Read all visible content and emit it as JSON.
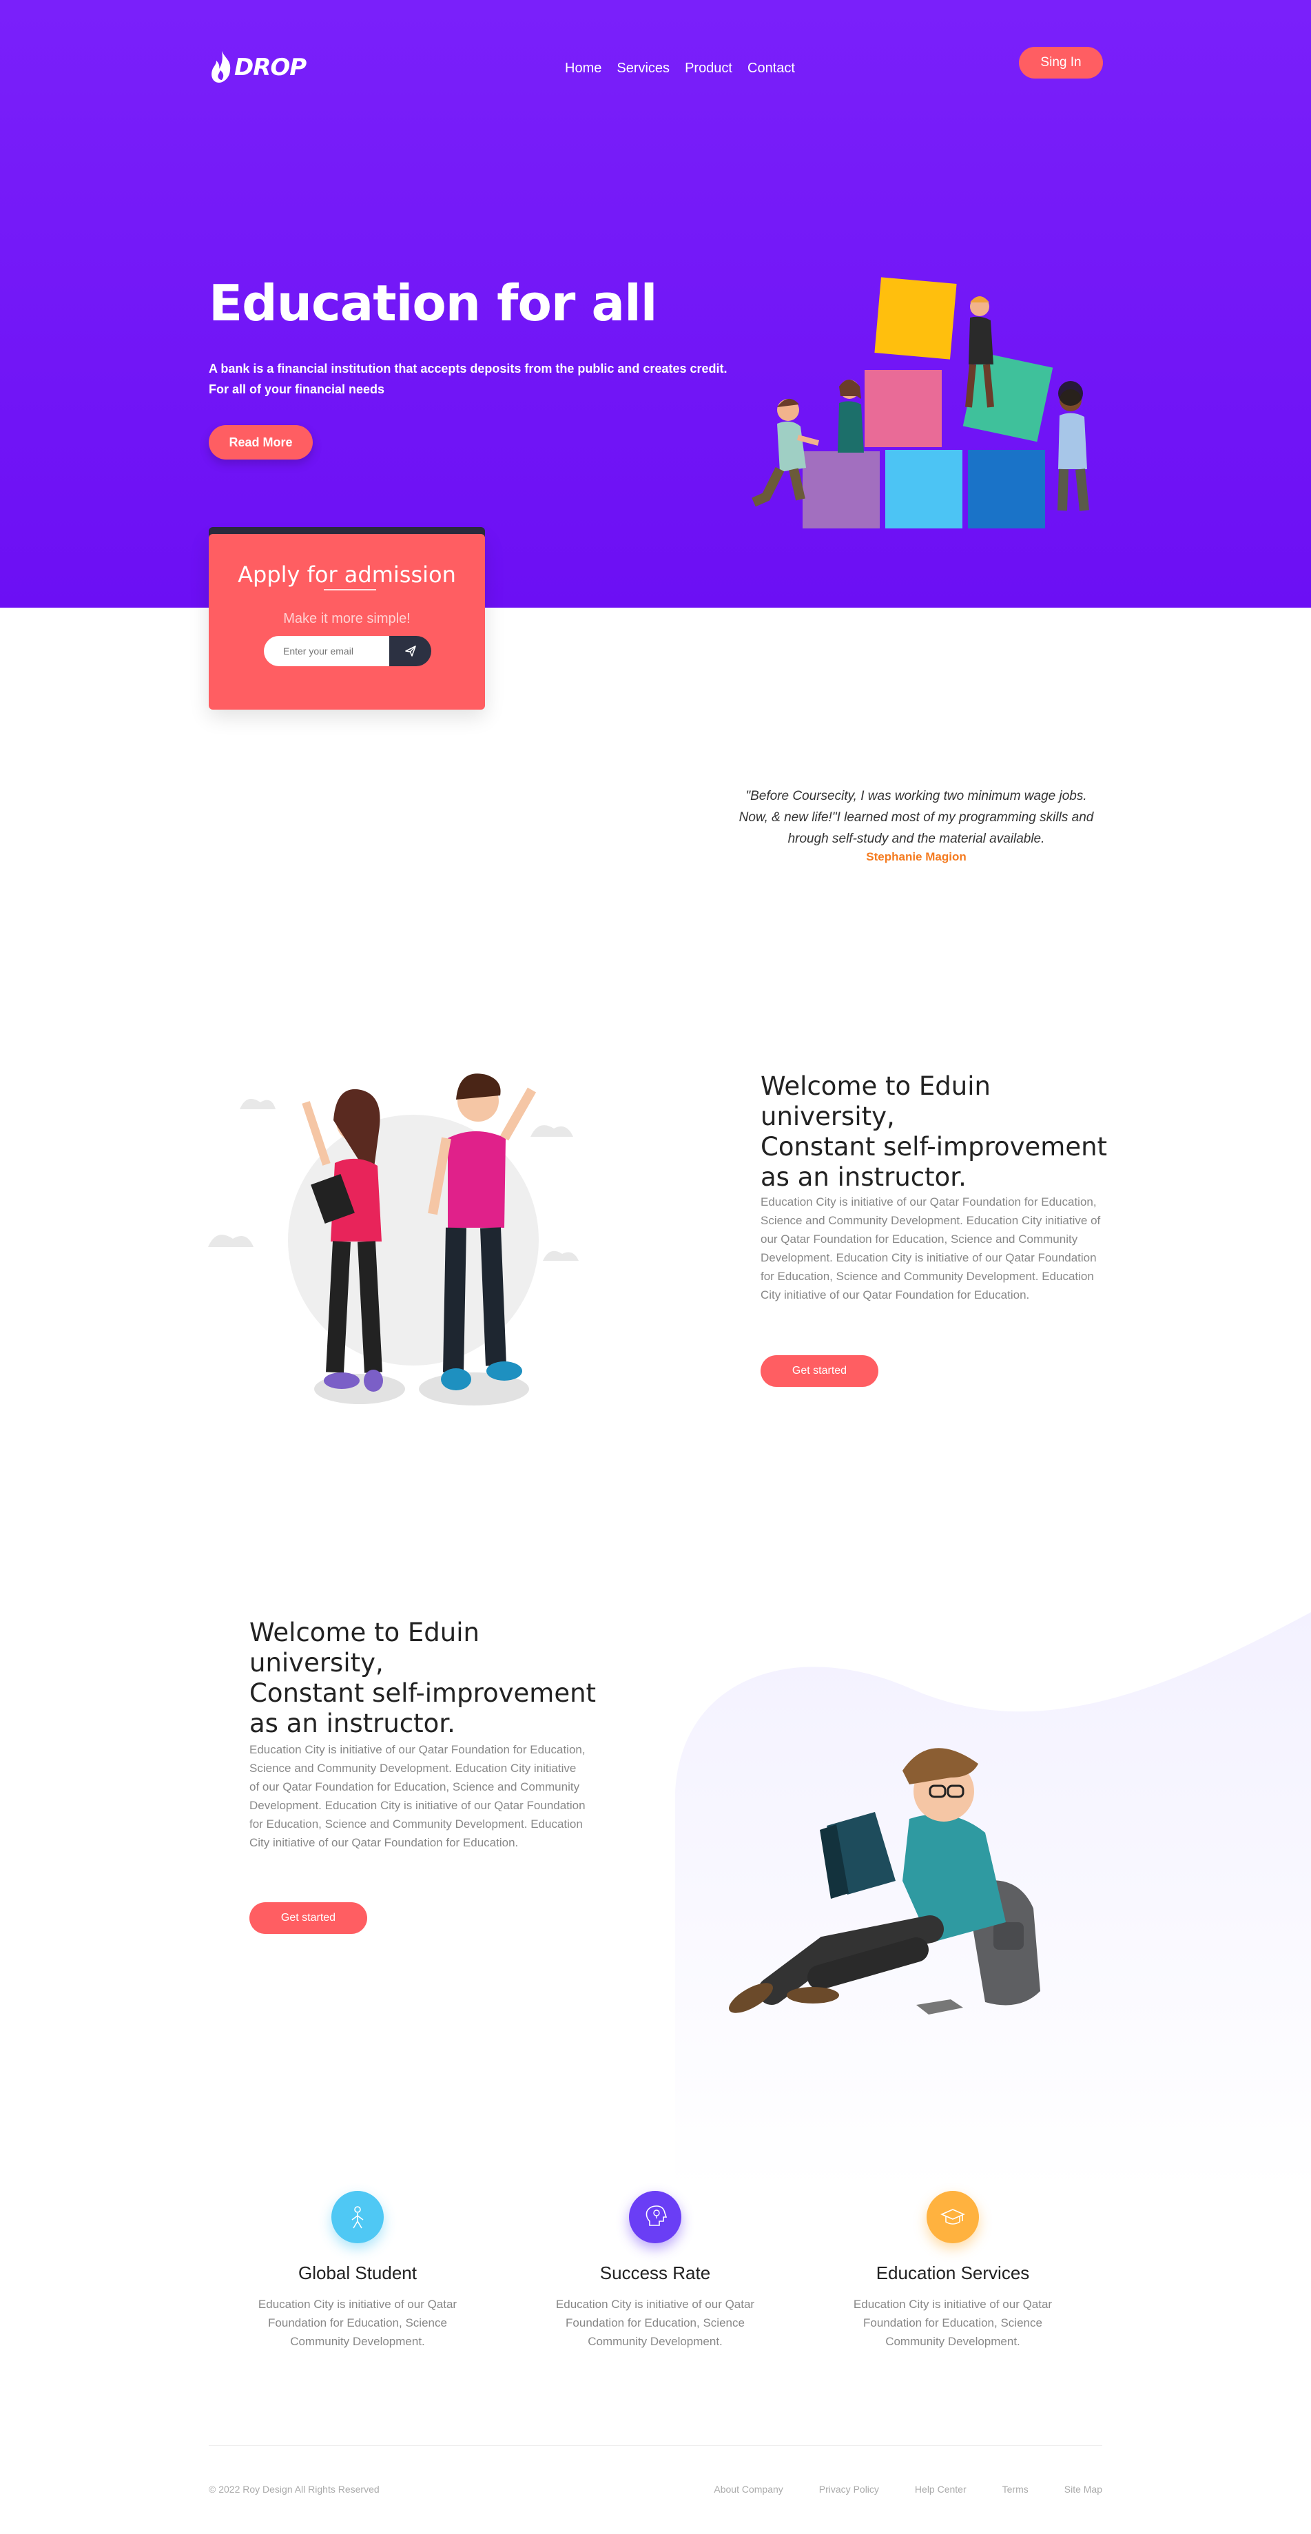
{
  "header": {
    "logo_text": "DROP",
    "nav": [
      {
        "label": "Home"
      },
      {
        "label": "Services"
      },
      {
        "label": "Product"
      },
      {
        "label": "Contact"
      }
    ],
    "signin_label": "Sing In"
  },
  "hero": {
    "title": "Education for all",
    "subtitle_line1": "A bank is a financial institution that accepts deposits from the public and creates credit.",
    "subtitle_line2": "For all of your financial needs",
    "cta_label": "Read More"
  },
  "admission": {
    "title": "Apply for admission",
    "subtitle": "Make it more simple!",
    "email_placeholder": "Enter your email"
  },
  "testimonial": {
    "quote": "\"Before Coursecity, I was working two minimum wage jobs. Now, & new life!\"I learned most of my programming skills and hrough self-study and the material available.",
    "author": "Stephanie Magion"
  },
  "section_one": {
    "title_line1": "Welcome to Eduin university,",
    "title_line2": "Constant self-improvement",
    "title_line3": "as an instructor.",
    "body": "Education City is initiative of our Qatar Foundation for Education, Science and Community Development. Education City initiative of our Qatar Foundation for Education, Science and Community Development. Education City is initiative of our Qatar Foundation for Education, Science and Community Development. Education City initiative of our Qatar Foundation for Education.",
    "cta_label": "Get started"
  },
  "section_two": {
    "title_line1": "Welcome to Eduin university,",
    "title_line2": "Constant self-improvement",
    "title_line3": "as an instructor.",
    "body": "Education City is initiative of our Qatar Foundation for Education, Science and Community Development. Education City initiative of our Qatar Foundation for Education, Science and Community Development. Education City is initiative of our Qatar Foundation for Education, Science and Community Development. Education City initiative of our Qatar Foundation for Education.",
    "cta_label": "Get started"
  },
  "features": [
    {
      "title": "Global Student",
      "body": "Education City is initiative of our Qatar Foundation for Education, Science Community Development.",
      "icon": "person-icon",
      "color": "#4fc8f4"
    },
    {
      "title": "Success Rate",
      "body": "Education City is initiative of our Qatar Foundation for Education, Science Community Development.",
      "icon": "lightbulb-head-icon",
      "color": "#6a3ef5"
    },
    {
      "title": "Education Services",
      "body": "Education City is initiative of our Qatar Foundation for Education, Science Community Development.",
      "icon": "graduation-cap-icon",
      "color": "#ffb23f"
    }
  ],
  "footer": {
    "copyright": "©   2022   Roy Design   All Rights Reserved",
    "links": [
      {
        "label": "About Company"
      },
      {
        "label": "Privacy Policy"
      },
      {
        "label": "Help Center"
      },
      {
        "label": "Terms"
      },
      {
        "label": "Site Map"
      }
    ]
  },
  "colors": {
    "hero_bg": "#7a20fa",
    "accent": "#ff5e62",
    "orange": "#f47b20"
  }
}
